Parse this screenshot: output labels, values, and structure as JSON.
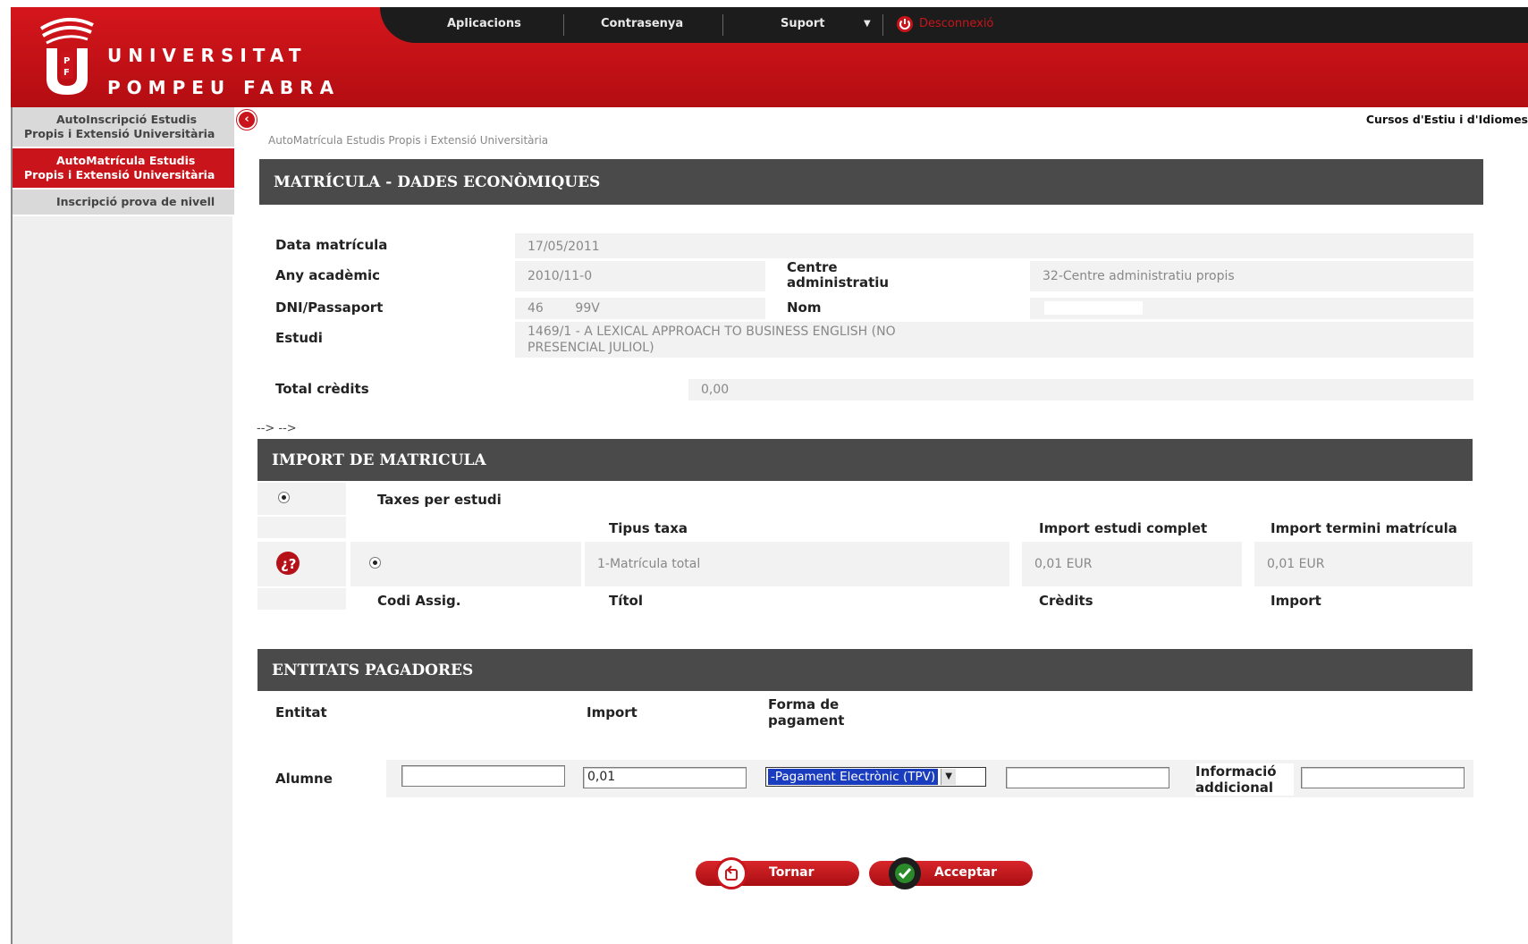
{
  "header": {
    "logo_line1": "UNIVERSITAT",
    "logo_line2": "POMPEU FABRA",
    "nav": [
      "Aplicacions",
      "Contrasenya",
      "Suport"
    ],
    "logout": "Desconnexió",
    "brand_color": "#c8141a"
  },
  "sidebar": {
    "items": [
      {
        "label": "AutoInscripció Estudis Propis i Extensió Universitària",
        "active": false
      },
      {
        "label": "AutoMatrícula Estudis Propis i Extensió Universitària",
        "active": true
      },
      {
        "label": "Inscripció prova de nivell",
        "active": false
      }
    ]
  },
  "top_right_link": "Cursos d'Estiu i d'Idiomes",
  "breadcrumb": "AutoMatrícula Estudis Propis i Extensió Universitària",
  "dades": {
    "title": "MATRÍCULA - DADES ECONÒMIQUES",
    "data_matricula_label": "Data matrícula",
    "data_matricula": "17/05/2011",
    "any_label": "Any acadèmic",
    "any": "2010/11-0",
    "centre_label": "Centre administratiu",
    "centre": "32-Centre administratiu propis",
    "dni_label": "DNI/Passaport",
    "dni": "46        99V",
    "nom_label": "Nom",
    "estudi_label": "Estudi",
    "estudi": "1469/1 - A LEXICAL APPROACH TO BUSINESS ENGLISH (NO PRESENCIAL JULIOL)",
    "total_label": "Total crèdits",
    "total": "0,00",
    "arrows": "--> -->"
  },
  "import": {
    "title": "IMPORT DE MATRICULA",
    "taxes_label": "Taxes per estudi",
    "col_tipus": "Tipus taxa",
    "col_complet": "Import estudi complet",
    "col_termini": "Import termini matrícula",
    "row_tipus": "1-Matrícula total",
    "row_complet": "0,01 EUR",
    "row_termini": "0,01 EUR",
    "col_codi": "Codi Assig.",
    "col_titol": "Títol",
    "col_credits": "Crèdits",
    "col_import": "Import"
  },
  "entitats": {
    "title": "ENTITATS PAGADORES",
    "col_entitat": "Entitat",
    "col_import": "Import",
    "col_forma": "Forma de pagament",
    "row_entitat": "Alumne",
    "import_value": "0,01",
    "forma_value": "-Pagament Electrònic (TPV)",
    "info_label": "Informació addicional"
  },
  "buttons": {
    "tornar": "Tornar",
    "acceptar": "Acceptar"
  }
}
